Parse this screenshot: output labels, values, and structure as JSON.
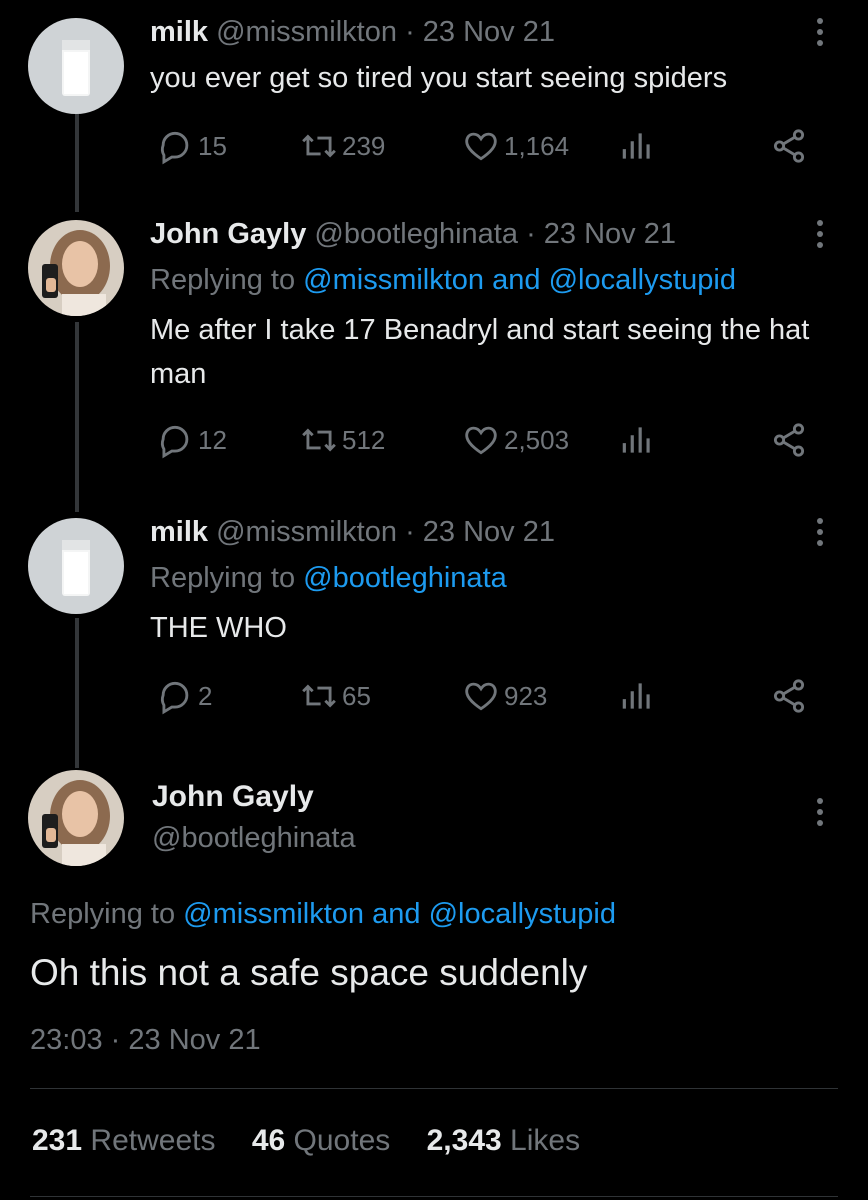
{
  "tweets": [
    {
      "name": "milk",
      "handle": "@missmilkton",
      "sep": "·",
      "date": "23 Nov 21",
      "replying_prefix": "",
      "text": "you ever get so tired you start seeing spiders",
      "replies": "15",
      "retweets": "239",
      "likes": "1,164"
    },
    {
      "name": "John Gayly",
      "handle": "@bootleghinata",
      "sep": "·",
      "date": "23 Nov 21",
      "replying_prefix": "Replying to",
      "reply_link_1": "@missmilkton",
      "reply_and": "and",
      "reply_link_2": "@locallystupid",
      "text": "Me after I take 17 Benadryl and start seeing the hat man",
      "replies": "12",
      "retweets": "512",
      "likes": "2,503"
    },
    {
      "name": "milk",
      "handle": "@missmilkton",
      "sep": "·",
      "date": "23 Nov 21",
      "replying_prefix": "Replying to",
      "reply_link_1": "@bootleghinata",
      "text": "THE WHO",
      "replies": "2",
      "retweets": "65",
      "likes": "923"
    }
  ],
  "main_tweet": {
    "name": "John Gayly",
    "handle": "@bootleghinata",
    "replying_prefix": "Replying to",
    "reply_link_1": "@missmilkton",
    "reply_and": "and",
    "reply_link_2": "@locallystupid",
    "text": "Oh this not a safe space suddenly",
    "time": "23:03",
    "sep": "·",
    "date": "23 Nov 21"
  },
  "stats": {
    "retweets_count": "231",
    "retweets_label": "Retweets",
    "quotes_count": "46",
    "quotes_label": "Quotes",
    "likes_count": "2,343",
    "likes_label": "Likes"
  },
  "colors": {
    "background": "#000000",
    "text": "#e7e9ea",
    "muted": "#71767b",
    "link": "#1d9bf0"
  },
  "icons": [
    "reply-icon",
    "retweet-icon",
    "like-icon",
    "views-icon",
    "share-icon",
    "more-icon"
  ]
}
